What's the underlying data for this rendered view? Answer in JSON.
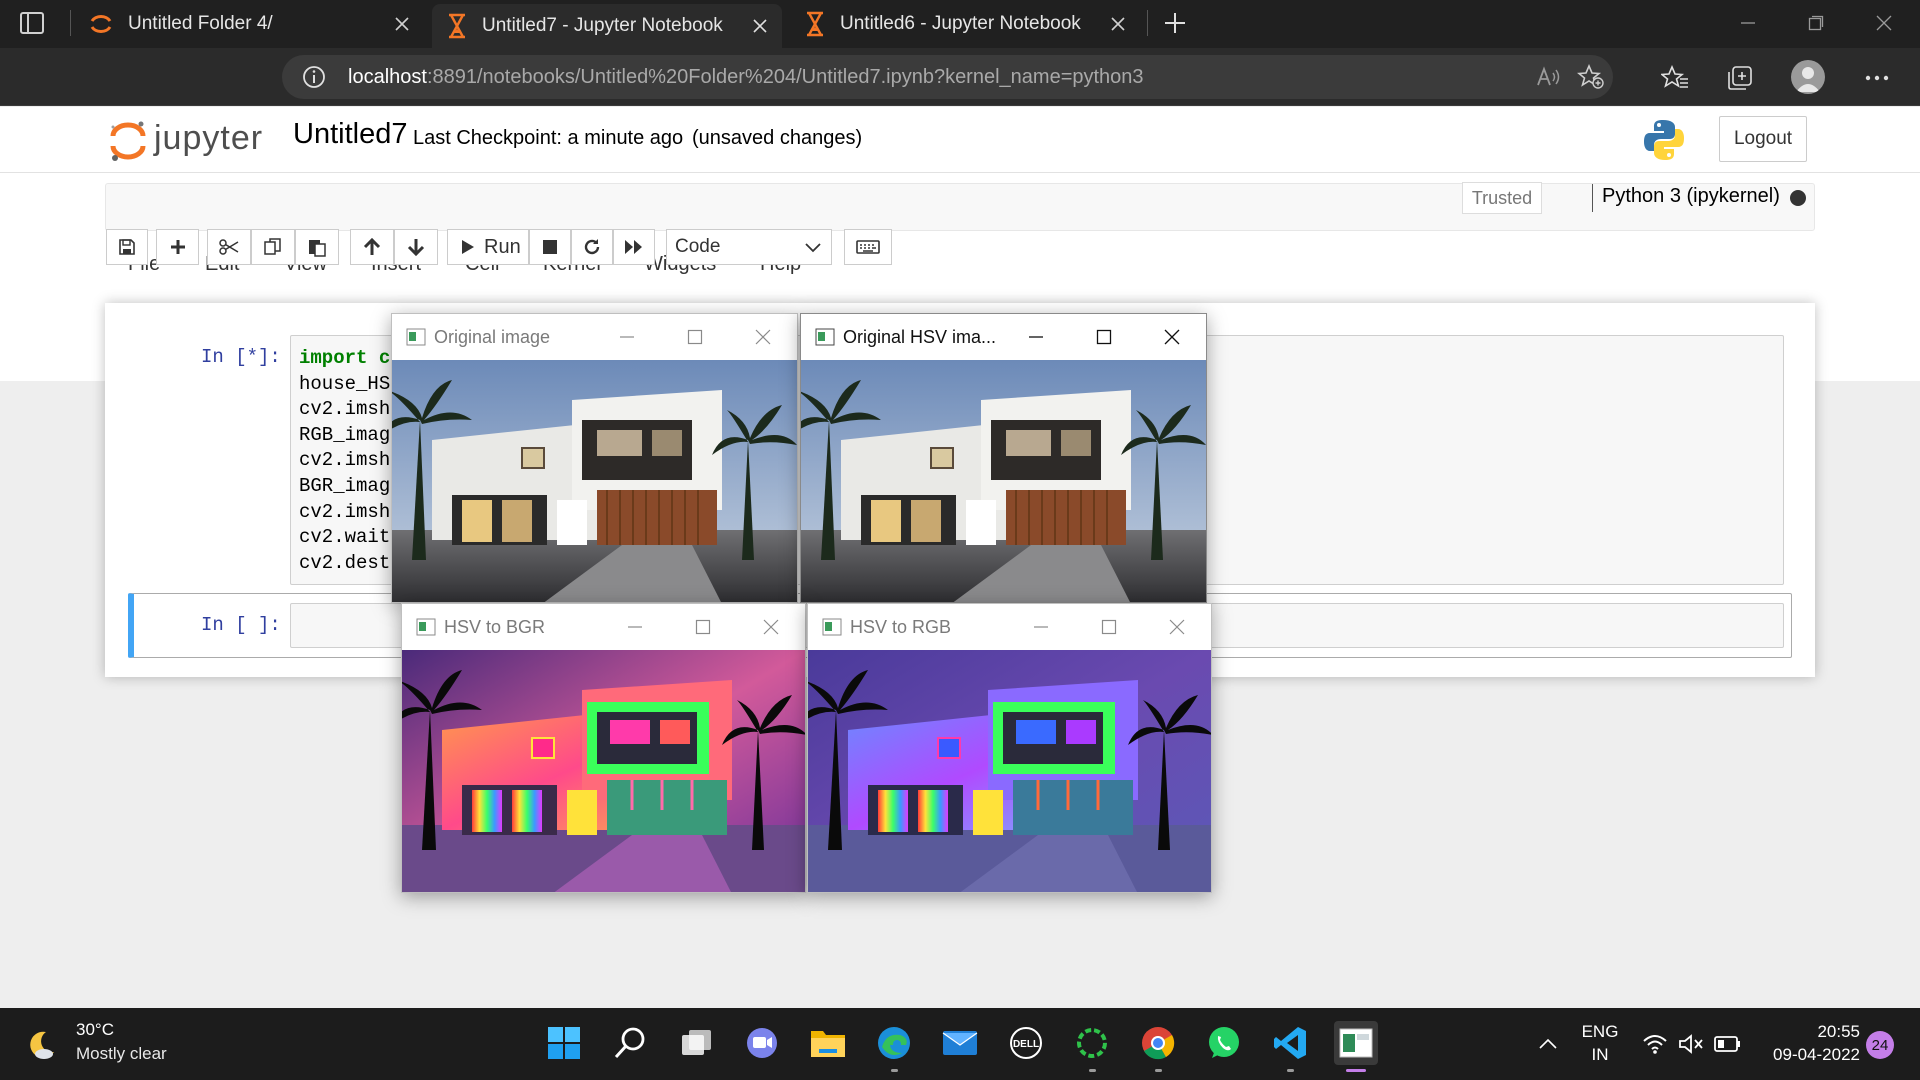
{
  "browser": {
    "tabs": [
      {
        "title": "Untitled Folder 4/",
        "icon": "jupyter-icon",
        "active": false
      },
      {
        "title": "Untitled7 - Jupyter Notebook",
        "icon": "hourglass-icon",
        "active": true
      },
      {
        "title": "Untitled6 - Jupyter Notebook",
        "icon": "hourglass-icon",
        "active": false
      }
    ],
    "url_host": "localhost",
    "url_path": ":8891/notebooks/Untitled%20Folder%204/Untitled7.ipynb?kernel_name=python3"
  },
  "jupyter": {
    "logo_text": "jupyter",
    "notebook_name": "Untitled7",
    "checkpoint": "Last Checkpoint: a minute ago",
    "unsaved": "(unsaved changes)",
    "logout": "Logout",
    "menu": [
      "File",
      "Edit",
      "View",
      "Insert",
      "Cell",
      "Kernel",
      "Widgets",
      "Help"
    ],
    "trusted": "Trusted",
    "kernel": "Python 3 (ipykernel)",
    "run_label": "Run",
    "cell_type": "Code",
    "cells": [
      {
        "prompt": "In [*]:",
        "lines": [
          "import c",
          "house_HS",
          "cv2.imsh",
          "RGB_imag",
          "cv2.imsh",
          "BGR_imag",
          "cv2.imsh",
          "cv2.wait",
          "cv2.dest"
        ]
      },
      {
        "prompt": "In [ ]:",
        "lines": []
      }
    ]
  },
  "cv_windows": [
    {
      "title": "Original image",
      "filter": "original"
    },
    {
      "title": "Original HSV ima...",
      "filter": "original"
    },
    {
      "title": "HSV to BGR",
      "filter": "warm"
    },
    {
      "title": "HSV to RGB",
      "filter": "cool"
    }
  ],
  "taskbar": {
    "weather_temp": "30°C",
    "weather_desc": "Mostly clear",
    "lang_1": "ENG",
    "lang_2": "IN",
    "time": "20:55",
    "date": "09-04-2022",
    "notif_count": "24"
  }
}
